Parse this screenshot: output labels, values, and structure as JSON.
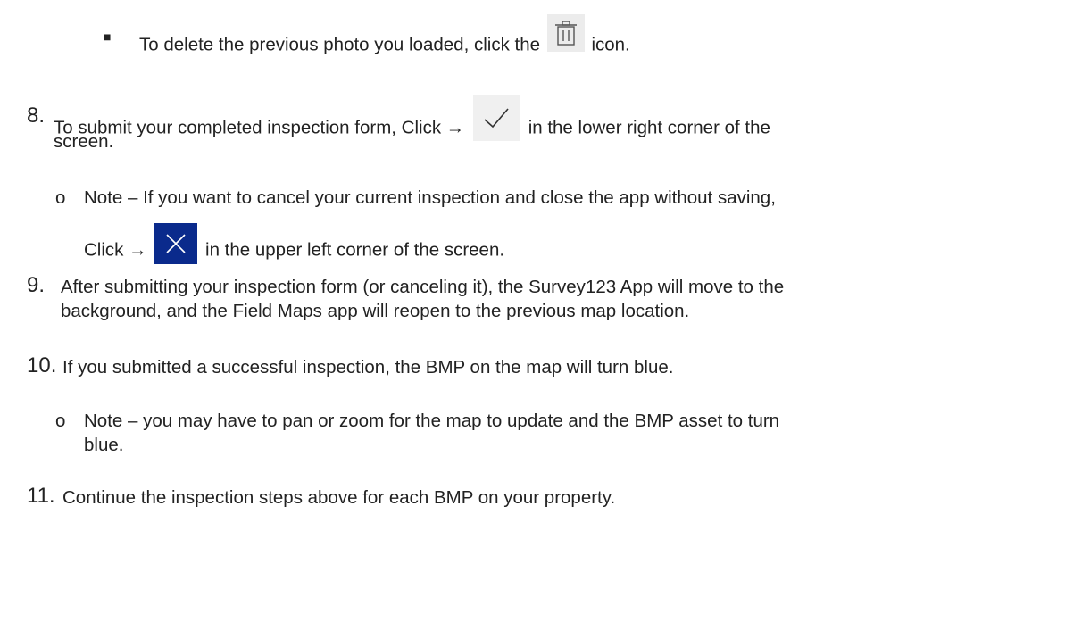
{
  "bullet_delete": {
    "marker": "■",
    "before": "To delete the previous photo you loaded, click the",
    "icon": "trash-can-icon",
    "after": "icon."
  },
  "step8": {
    "number": "8.",
    "line1_before": "To submit your completed inspection form, Click →",
    "icon": "checkmark-icon",
    "line1_after": "in the lower right corner of the",
    "line2": "screen."
  },
  "note_cancel": {
    "marker": "o",
    "line1": "Note – If you want to cancel your current inspection and close the app without saving,",
    "line2_before": "Click →",
    "icon": "close-x-icon",
    "line2_after": "in the upper left corner of the screen."
  },
  "step9": {
    "number": "9.",
    "line1": "After submitting your inspection form (or canceling it), the Survey123 App will move to the",
    "line2": "background, and the Field Maps app will reopen to the previous map location."
  },
  "step10": {
    "number": "10.",
    "text": "If you submitted a successful inspection, the BMP on the map will turn blue."
  },
  "note_pan": {
    "marker": "o",
    "line1": "Note – you may have to pan or zoom for the map to update and the BMP asset to turn",
    "line2": "blue."
  },
  "step11": {
    "number": "11.",
    "text": "Continue the inspection steps above for each BMP on your property."
  },
  "colors": {
    "text": "#222222",
    "close_icon_bg": "#0a2a8c",
    "icon_bg": "#ececec"
  }
}
